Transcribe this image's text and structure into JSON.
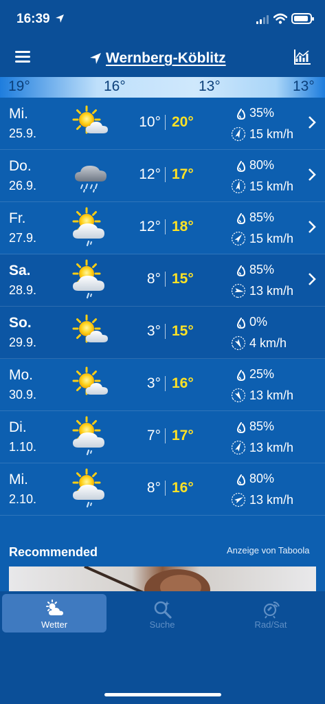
{
  "status": {
    "time": "16:39"
  },
  "header": {
    "location": "Wernberg-Köblitz"
  },
  "temp_strip": [
    "19°",
    "16°",
    "13°",
    "13°"
  ],
  "days": [
    {
      "day": "Mi.",
      "date": "25.9.",
      "min": "10°",
      "max": "20°",
      "rain": "35%",
      "wind": "15 km/h",
      "icon": "sun-cloud-icon",
      "chevron": true
    },
    {
      "day": "Do.",
      "date": "26.9.",
      "min": "12°",
      "max": "17°",
      "rain": "80%",
      "wind": "15 km/h",
      "icon": "rain-cloud-icon",
      "chevron": true
    },
    {
      "day": "Fr.",
      "date": "27.9.",
      "min": "12°",
      "max": "18°",
      "rain": "85%",
      "wind": "15 km/h",
      "icon": "sun-cloud-rain-icon",
      "chevron": true
    },
    {
      "day": "Sa.",
      "date": "28.9.",
      "min": "8°",
      "max": "15°",
      "rain": "85%",
      "wind": "13 km/h",
      "icon": "sun-cloud-rain-icon",
      "chevron": true
    },
    {
      "day": "So.",
      "date": "29.9.",
      "min": "3°",
      "max": "15°",
      "rain": "0%",
      "wind": "4 km/h",
      "icon": "sun-cloud-icon",
      "chevron": false
    },
    {
      "day": "Mo.",
      "date": "30.9.",
      "min": "3°",
      "max": "16°",
      "rain": "25%",
      "wind": "13 km/h",
      "icon": "sun-cloud-icon",
      "chevron": false
    },
    {
      "day": "Di.",
      "date": "1.10.",
      "min": "7°",
      "max": "17°",
      "rain": "85%",
      "wind": "13 km/h",
      "icon": "sun-cloud-rain-icon",
      "chevron": false
    },
    {
      "day": "Mi.",
      "date": "2.10.",
      "min": "8°",
      "max": "16°",
      "rain": "80%",
      "wind": "13 km/h",
      "icon": "sun-cloud-rain-icon",
      "chevron": false
    }
  ],
  "recommended": {
    "title": "Recommended",
    "ad_label": "Anzeige von Taboola"
  },
  "tabs": [
    {
      "label": "Wetter",
      "active": true
    },
    {
      "label": "Suche",
      "active": false
    },
    {
      "label": "Rad/Sat",
      "active": false
    }
  ],
  "colors": {
    "background": "#0d5fb0",
    "header": "#0b4f98",
    "max_temp": "#ffe225"
  }
}
